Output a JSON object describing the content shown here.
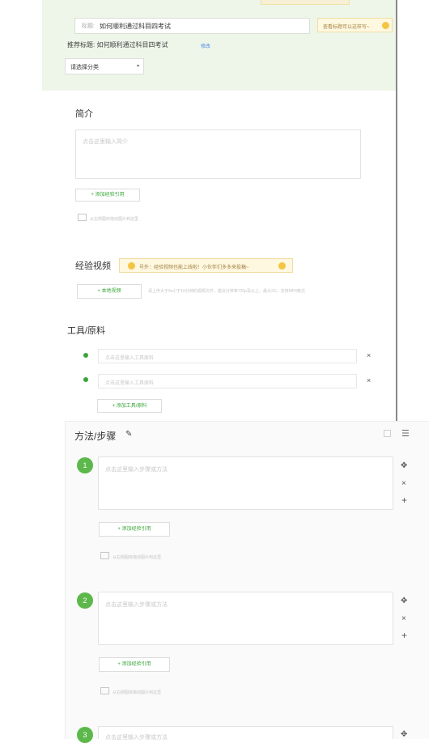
{
  "title_field": {
    "label": "标题:",
    "value": "如何顺利通过科目四考试"
  },
  "title_tip": "查看标题可以这样写~",
  "recommend": {
    "label": "推荐标题:",
    "value": "如何顺利通过科目四考试",
    "edit": "修改"
  },
  "category": {
    "placeholder": "请选择分类"
  },
  "intro": {
    "heading": "简介",
    "placeholder": "点击这里输入简介",
    "add_ref": "+ 添加经验引用",
    "img_hint": "从右侧图库拖动图片到这里"
  },
  "video": {
    "heading": "经验视频",
    "tip": "号外：经验视频也能上线啦！小伙伴们多多来投稿~",
    "upload": "+ 本地视频",
    "hint": "请上传大于5s小于10分钟的视频文件，建议分辨率720p及以上，最大2G，支持MP4格式"
  },
  "tools": {
    "heading": "工具/原料",
    "items": [
      {
        "placeholder": "点击这里输入工具原料"
      },
      {
        "placeholder": "点击这里输入工具原料"
      }
    ],
    "add": "+ 添加工具/原料"
  },
  "steps": {
    "heading": "方法/步骤",
    "items": [
      {
        "num": "1",
        "placeholder": "点击这里输入步骤或方法",
        "add_ref": "+ 添加经验引用",
        "img_hint": "从右侧图库拖动图片到这里"
      },
      {
        "num": "2",
        "placeholder": "点击这里输入步骤或方法",
        "add_ref": "+ 添加经验引用",
        "img_hint": "从右侧图库拖动图片到这里"
      },
      {
        "num": "3",
        "placeholder": "点击这里输入步骤或方法"
      }
    ]
  },
  "icons": {
    "close": "×",
    "move": "✥",
    "plus": "+",
    "pencil": "✎",
    "list": "☰",
    "arrow": "▾"
  },
  "colors": {
    "accent_green": "#3aa53a",
    "step_green": "#5cb84a",
    "panel_bg": "#eef6ea",
    "tip_bg": "#fff8e1"
  }
}
